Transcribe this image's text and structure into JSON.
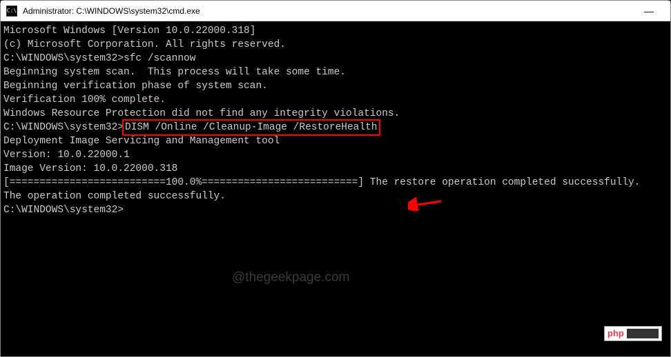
{
  "titlebar": {
    "icon_label": "C:\\",
    "title": "Administrator: C:\\WINDOWS\\system32\\cmd.exe",
    "minimize": "—"
  },
  "terminal": {
    "line1": "Microsoft Windows [Version 10.0.22000.318]",
    "line2": "(c) Microsoft Corporation. All rights reserved.",
    "line3": "",
    "prompt1": "C:\\WINDOWS\\system32>",
    "cmd1": "sfc /scannow",
    "line5": "",
    "line6": "Beginning system scan.  This process will take some time.",
    "line7": "",
    "line8": "Beginning verification phase of system scan.",
    "line9": "Verification 100% complete.",
    "line10": "",
    "line11": "Windows Resource Protection did not find any integrity violations.",
    "line12": "",
    "prompt2": "C:\\WINDOWS\\system32>",
    "cmd2": "DISM /Online /Cleanup-Image /RestoreHealth",
    "line14": "",
    "line15": "Deployment Image Servicing and Management tool",
    "line16": "Version: 10.0.22000.1",
    "line17": "",
    "line18": "Image Version: 10.0.22000.318",
    "line19": "",
    "line20": "[==========================100.0%==========================] The restore operation completed successfully.",
    "line21": "The operation completed successfully.",
    "line22": "",
    "prompt3": "C:\\WINDOWS\\system32>"
  },
  "watermark": "@thegeekpage.com",
  "badge": {
    "left": "php"
  }
}
